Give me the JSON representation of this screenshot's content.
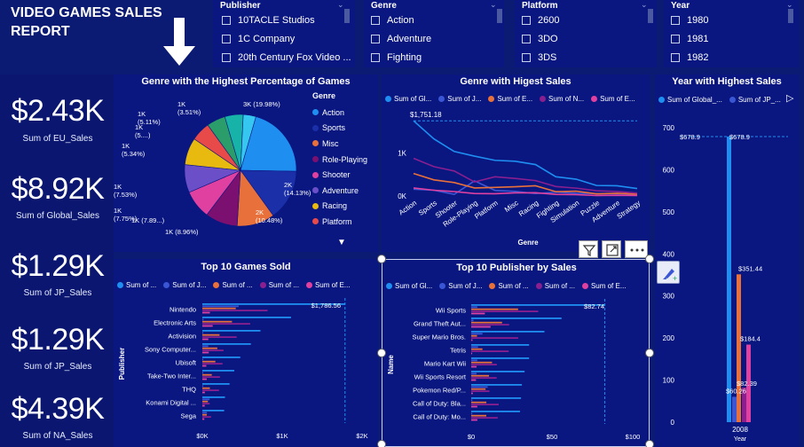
{
  "report_title": "VIDEO GAMES SALES REPORT",
  "report_title_line1": "VIDEO GAMES SALES",
  "report_title_line2": "REPORT",
  "slicers": [
    {
      "title": "Publisher",
      "items": [
        "10TACLE Studios",
        "1C Company",
        "20th Century Fox Video ..."
      ]
    },
    {
      "title": "Genre",
      "items": [
        "Action",
        "Adventure",
        "Fighting"
      ]
    },
    {
      "title": "Platform",
      "items": [
        "2600",
        "3DO",
        "3DS"
      ]
    },
    {
      "title": "Year",
      "items": [
        "1980",
        "1981",
        "1982"
      ]
    }
  ],
  "kpis": [
    {
      "value": "$2.43K",
      "label": "Sum of EU_Sales"
    },
    {
      "value": "$8.92K",
      "label": "Sum of Global_Sales"
    },
    {
      "value": "$1.29K",
      "label": "Sum of JP_Sales"
    },
    {
      "value": "$1.29K",
      "label": "Sum of JP_Sales"
    },
    {
      "value": "$4.39K",
      "label": "Sum of NA_Sales"
    }
  ],
  "colors": {
    "global": "#1f8ef1",
    "jp": "#3a56d4",
    "eu": "#e8703a",
    "na": "#8a1f8f",
    "other": "#e040a0"
  },
  "pie": {
    "title": "Genre with the Highest Percentage of Games",
    "legend_title": "Genre",
    "legend": [
      {
        "name": "Action",
        "color": "#1f8ef1"
      },
      {
        "name": "Sports",
        "color": "#1b2fa8"
      },
      {
        "name": "Misc",
        "color": "#e8703a"
      },
      {
        "name": "Role-Playing",
        "color": "#7b1070"
      },
      {
        "name": "Shooter",
        "color": "#e040a0"
      },
      {
        "name": "Adventure",
        "color": "#6a4fc9"
      },
      {
        "name": "Racing",
        "color": "#e8b90e"
      },
      {
        "name": "Platform",
        "color": "#e84a4a"
      }
    ],
    "labels": [
      "3K (19.98%)",
      "2K (14.13%)",
      "2K (10.48%)",
      "1K (8.96%)",
      "1K (7.89...)",
      "1K (7.75%)",
      "1K (7.53%)",
      "1K (5.34%)",
      "1K (5....)",
      "1K (5.11%)",
      "1K (3.51%)"
    ]
  },
  "chart_data": [
    {
      "type": "pie",
      "title": "Genre with the Highest Percentage of Games",
      "legend_title": "Genre",
      "categories": [
        "Action",
        "Sports",
        "Misc",
        "Role-Playing",
        "Shooter",
        "Adventure",
        "Racing",
        "Platform",
        "",
        "",
        ""
      ],
      "values": [
        19.98,
        14.13,
        10.48,
        8.96,
        7.89,
        7.75,
        7.53,
        5.34,
        5.2,
        5.11,
        3.51
      ],
      "colors": [
        "#1f8ef1",
        "#1b2fa8",
        "#e8703a",
        "#7b1070",
        "#e040a0",
        "#6a4fc9",
        "#e8b90e",
        "#e84a4a",
        "#2a9d6a",
        "#17b2a8",
        "#36c7f0"
      ]
    },
    {
      "type": "line",
      "title": "Genre with Higest Sales",
      "xlabel": "Genre",
      "categories": [
        "Action",
        "Sports",
        "Shooter",
        "Role-Playing",
        "Platform",
        "Misc",
        "Racing",
        "Fighting",
        "Simulation",
        "Puzzle",
        "Adventure",
        "Strategy"
      ],
      "yticks": [
        "0K",
        "1K"
      ],
      "ylim": [
        0,
        1900
      ],
      "ref_value": 1751.18,
      "ref_label": "$1,751.18",
      "series": [
        {
          "name": "Sum of Gl...",
          "values": [
            1751.18,
            1330,
            1037,
            928,
            831,
            809,
            732,
            448,
            392,
            245,
            239,
            175
          ]
        },
        {
          "name": "Sum of J...",
          "values": [
            159,
            136,
            38,
            352,
            131,
            108,
            57,
            88,
            64,
            57,
            52,
            49
          ]
        },
        {
          "name": "Sum of E...",
          "values": [
            525,
            376,
            313,
            188,
            201,
            215,
            238,
            101,
            113,
            50,
            64,
            45
          ]
        },
        {
          "name": "Sum of N...",
          "values": [
            877,
            684,
            582,
            327,
            447,
            410,
            359,
            221,
            183,
            123,
            105,
            68
          ]
        },
        {
          "name": "Sum of E...",
          "values": [
            187,
            134,
            103,
            59,
            52,
            74,
            77,
            37,
            31,
            12,
            17,
            11
          ]
        }
      ]
    },
    {
      "type": "bar",
      "title": "Year with Highest Sales",
      "xlabel": "Year",
      "categories": [
        "2008"
      ],
      "yticks": [
        0,
        100,
        200,
        300,
        400,
        500,
        600,
        700
      ],
      "ylim": [
        0,
        700
      ],
      "ref_value": 678.9,
      "ref_label": "$678.9",
      "series": [
        {
          "name": "Sum of Global_...",
          "values": [
            678.9
          ]
        },
        {
          "name": "Sum of JP_...",
          "values": [
            60.26
          ]
        },
        {
          "name": "",
          "values": [
            184.4
          ]
        },
        {
          "name": "",
          "values": [
            351.44
          ]
        },
        {
          "name": "",
          "values": [
            82.39
          ]
        }
      ],
      "data_labels": [
        "$678.9",
        "$60.26",
        "$184.4",
        "$351.44",
        "$82.39"
      ]
    },
    {
      "type": "bar",
      "title": "Top 10 Games Sold",
      "ylabel": "Publisher",
      "categories": [
        "Nintendo",
        "Electronic Arts",
        "Activision",
        "Sony Computer...",
        "Ubisoft",
        "Take-Two Inter...",
        "THQ",
        "Konami Digital ...",
        "Sega"
      ],
      "xticks": [
        "$0K",
        "$1K",
        "$2K"
      ],
      "xlim": [
        0,
        2000
      ],
      "ref_label": "$1,786.56",
      "series": [
        {
          "name": "Sum of ...",
          "values": [
            1786.56,
            1110.32,
            727.46,
            607.5,
            474.72,
            399.54,
            340.77,
            283.64,
            272.99
          ]
        },
        {
          "name": "Sum of J...",
          "values": [
            454.99,
            14.35,
            6.54,
            74.1,
            7.5,
            5.94,
            5.15,
            91.3,
            57.04
          ]
        },
        {
          "name": "Sum of ...",
          "values": [
            418.74,
            371.27,
            215.53,
            187.72,
            163.32,
            118.14,
            94.72,
            69.69,
            56.19
          ]
        },
        {
          "name": "Sum of ...",
          "values": [
            816.87,
            599.5,
            429.7,
            265.22,
            253.43,
            220.49,
            208.77,
            92.16,
            109.4
          ]
        },
        {
          "name": "Sum of E...",
          "values": [
            95.33,
            129.77,
            75.34,
            80.45,
            50.26,
            55.2,
            32.14,
            30.87,
            24.52
          ]
        }
      ]
    },
    {
      "type": "bar",
      "title": "Top 10 Publisher by Sales",
      "ylabel": "Name",
      "categories": [
        "Wii Sports",
        "Grand Theft Aut...",
        "Super Mario Bros.",
        "Tetris",
        "Mario Kart Wii",
        "Wii Sports Resort",
        "Pokemon Red/P...",
        "Call of Duty: Bla...",
        "Call of Duty: Mo..."
      ],
      "xticks": [
        "$0",
        "$50",
        "$100"
      ],
      "xlim": [
        0,
        100
      ],
      "ref_label": "$82.74",
      "series": [
        {
          "name": "Sum of Gl...",
          "values": [
            82.74,
            55.92,
            45.31,
            35.84,
            35.82,
            33.0,
            31.37,
            30.83,
            30.18
          ]
        },
        {
          "name": "Sum of J...",
          "values": [
            3.77,
            1.39,
            6.96,
            4.22,
            3.79,
            3.28,
            10.22,
            0.69,
            0.62
          ]
        },
        {
          "name": "Sum of ...",
          "values": [
            29.02,
            19.08,
            3.58,
            6.95,
            12.88,
            11.01,
            8.89,
            9.37,
            9.34
          ]
        },
        {
          "name": "Sum of ...",
          "values": [
            41.49,
            23.46,
            29.08,
            23.2,
            15.85,
            15.75,
            11.27,
            17.01,
            16.42
          ]
        },
        {
          "name": "Sum of E...",
          "values": [
            8.46,
            11.98,
            0.77,
            0.58,
            3.31,
            2.96,
            1.0,
            3.76,
            3.8
          ]
        }
      ]
    }
  ],
  "line_chart": {
    "title": "Genre with Higest Sales",
    "legend": [
      "Sum of Gl...",
      "Sum of J...",
      "Sum of E...",
      "Sum of N...",
      "Sum of E..."
    ],
    "xlabel": "Genre"
  },
  "year_chart": {
    "title": "Year with Highest Sales",
    "legend": [
      "Sum of Global_...",
      "Sum of JP_..."
    ],
    "xlabel": "Year"
  },
  "games_chart": {
    "title": "Top 10 Games Sold",
    "legend": [
      "Sum of ...",
      "Sum of J...",
      "Sum of ...",
      "Sum of ...",
      "Sum of E..."
    ],
    "ylabel": "Publisher"
  },
  "publisher_chart": {
    "title": "Top 10 Publisher by Sales",
    "legend": [
      "Sum of Gl...",
      "Sum of J...",
      "Sum of ...",
      "Sum of ...",
      "Sum of E..."
    ],
    "ylabel": "Name"
  },
  "icons": [
    "down-arrow-icon",
    "chevron-down-icon",
    "filter-icon",
    "focus-mode-icon",
    "more-options-icon",
    "format-brush-icon",
    "play-arrow-icon"
  ]
}
